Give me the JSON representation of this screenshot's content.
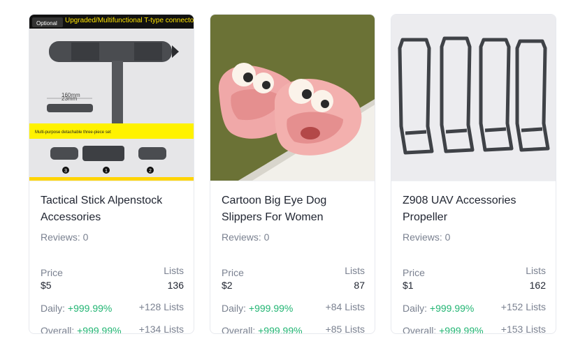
{
  "cards": [
    {
      "title": "Tactical Stick Alpenstock Accessories",
      "reviews": "Reviews: 0",
      "price_label": "Price",
      "price": "$5",
      "lists_label": "Lists",
      "lists": "136",
      "daily_label": "Daily:",
      "daily_pct": "+999.99%",
      "daily_lists": "+128 Lists",
      "overall_label": "Overall:",
      "overall_pct": "+999.99%",
      "overall_lists": "+134 Lists",
      "image": {
        "badge": "Optional",
        "headline": "Upgraded/Multifunctional T-type connector",
        "dim_length": "160mm",
        "dim_diameter": "23mm",
        "banner": "Multi-purpose detachable three-piece set",
        "parts": [
          "3",
          "1",
          "2"
        ]
      }
    },
    {
      "title": "Cartoon Big Eye Dog Slippers For Women",
      "reviews": "Reviews: 0",
      "price_label": "Price",
      "price": "$2",
      "lists_label": "Lists",
      "lists": "87",
      "daily_label": "Daily:",
      "daily_pct": "+999.99%",
      "daily_lists": "+84 Lists",
      "overall_label": "Overall:",
      "overall_pct": "+999.99%",
      "overall_lists": "+85 Lists"
    },
    {
      "title": "Z908 UAV Accessories Propeller",
      "reviews": "Reviews: 0",
      "price_label": "Price",
      "price": "$1",
      "lists_label": "Lists",
      "lists": "162",
      "daily_label": "Daily:",
      "daily_pct": "+999.99%",
      "daily_lists": "+152 Lists",
      "overall_label": "Overall:",
      "overall_pct": "+999.99%",
      "overall_lists": "+153 Lists"
    }
  ],
  "colors": {
    "positive": "#22b573",
    "text": "#1f2430",
    "muted": "#7a8190",
    "border": "#e7e9ee"
  }
}
